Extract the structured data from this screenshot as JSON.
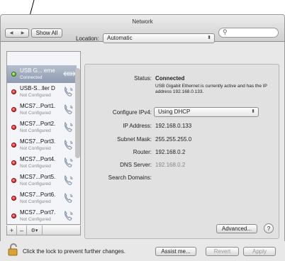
{
  "window": {
    "title": "Network"
  },
  "toolbar": {
    "show_all_label": "Show All"
  },
  "search": {
    "placeholder": ""
  },
  "location": {
    "label": "Location:",
    "value": "Automatic"
  },
  "services": [
    {
      "name": "USB G... erne",
      "status": "Connected",
      "indicator": "green",
      "icon": "ethernet-icon",
      "selected": true
    },
    {
      "name": "USB-S...ller D",
      "status": "Not Configured",
      "indicator": "red",
      "icon": "phone-icon"
    },
    {
      "name": "MCS7...Port1.",
      "status": "Not Configured",
      "indicator": "red",
      "icon": "phone-icon"
    },
    {
      "name": "MCS7...Port2.",
      "status": "Not Configured",
      "indicator": "red",
      "icon": "phone-icon"
    },
    {
      "name": "MCS7...Port3.",
      "status": "Not Configured",
      "indicator": "red",
      "icon": "phone-icon"
    },
    {
      "name": "MCS7...Port4.",
      "status": "Not Configured",
      "indicator": "red",
      "icon": "phone-icon"
    },
    {
      "name": "MCS7...Port5.",
      "status": "Not Configured",
      "indicator": "red",
      "icon": "phone-icon"
    },
    {
      "name": "MCS7...Port6.",
      "status": "Not Configured",
      "indicator": "red",
      "icon": "phone-icon"
    },
    {
      "name": "MCS7...Port7.",
      "status": "Not Configured",
      "indicator": "red",
      "icon": "phone-icon"
    }
  ],
  "list_toolbar": {
    "add": "+",
    "remove": "–",
    "action": "⚙▾"
  },
  "details": {
    "status_label": "Status:",
    "status_value": "Connected",
    "status_description": "USB Gigabit Ethernet is currently active and has the IP address 192.168.0.133.",
    "configure_label": "Configure IPv4:",
    "configure_value": "Using DHCP",
    "ip_label": "IP Address:",
    "ip_value": "192.168.0.133",
    "subnet_label": "Subnet Mask:",
    "subnet_value": "255.255.255.0",
    "router_label": "Router:",
    "router_value": "192.168.0.2",
    "dns_label": "DNS Server:",
    "dns_value": "192.168.0.2",
    "search_domains_label": "Search Domains:"
  },
  "buttons": {
    "advanced": "Advanced...",
    "help": "?",
    "assist": "Assist me...",
    "revert": "Revert",
    "apply": "Apply"
  },
  "lock_text": "Click the lock to prevent further changes.",
  "colors": {
    "selection": "#8d9ab0",
    "connected": "#3e9b10",
    "not_configured": "#cc0000"
  }
}
